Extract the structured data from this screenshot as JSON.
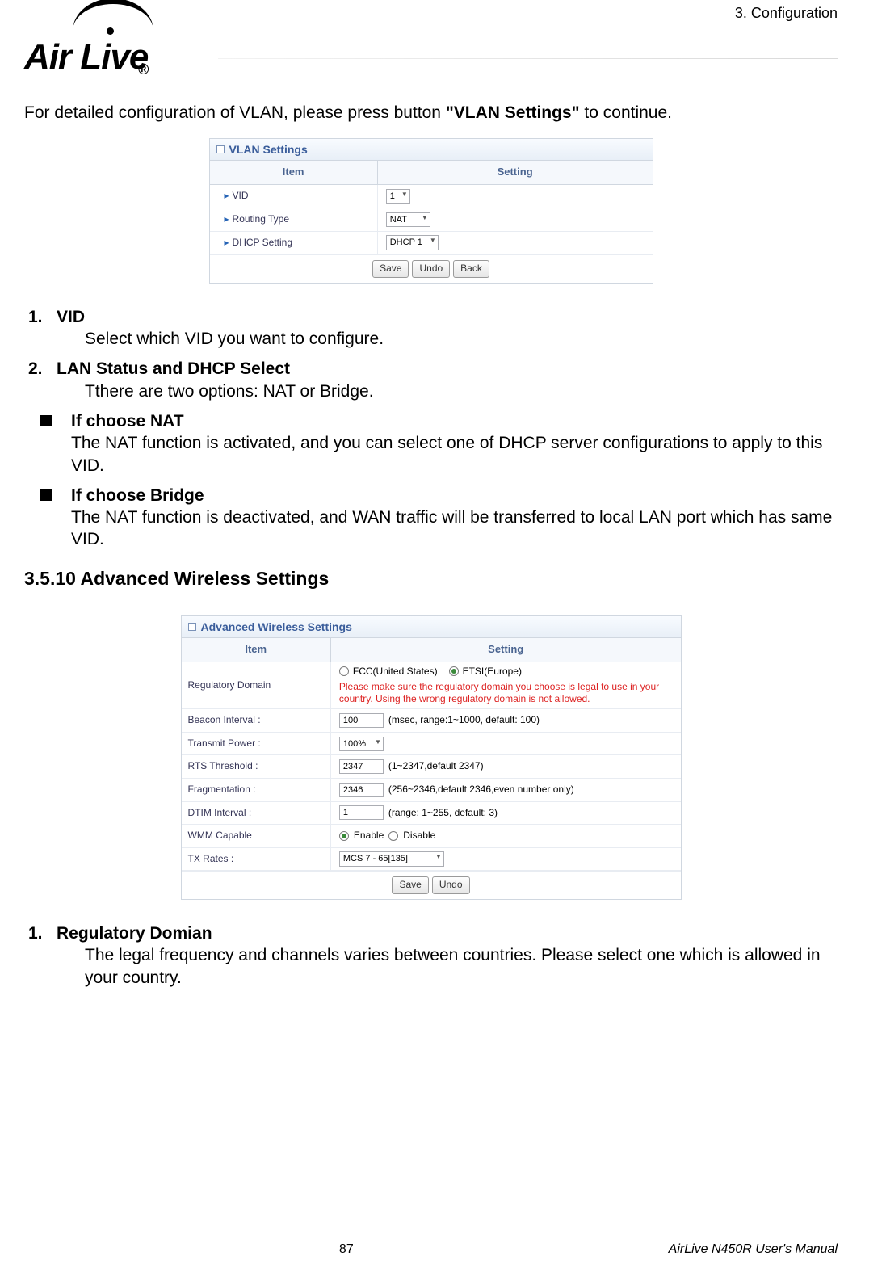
{
  "chapter": "3.  Configuration",
  "logo_text": "Air Live",
  "logo_reg": "®",
  "intro_pre": "For detailed configuration of VLAN, please press button ",
  "intro_bold": "\"VLAN Settings\"",
  "intro_post": " to continue.",
  "vlan": {
    "title": "VLAN Settings",
    "col_item": "Item",
    "col_setting": "Setting",
    "rows": {
      "vid": {
        "label": "VID",
        "value": "1"
      },
      "routing": {
        "label": "Routing Type",
        "value": "NAT"
      },
      "dhcp": {
        "label": "DHCP Setting",
        "value": "DHCP 1"
      }
    },
    "btn_save": "Save",
    "btn_undo": "Undo",
    "btn_back": "Back"
  },
  "items": {
    "n1": "1.",
    "t1": "VID",
    "b1": "Select which VID you want to configure.",
    "n2": "2.",
    "t2": "LAN Status and DHCP Select",
    "b2": "Tthere are two options: NAT or Bridge.",
    "bt1": "If choose NAT",
    "bb1": "The NAT function is activated, and you can select one of DHCP server configurations to apply to this VID.",
    "bt2": "If choose Bridge",
    "bb2": "The NAT function is deactivated, and WAN traffic will be transferred to local LAN port which has same VID."
  },
  "section_heading": "3.5.10 Advanced Wireless Settings",
  "aws": {
    "title": "Advanced Wireless Settings",
    "col_item": "Item",
    "col_setting": "Setting",
    "reg_label": "Regulatory Domain",
    "reg_opt1": "FCC(United States)",
    "reg_opt2": "ETSI(Europe)",
    "reg_warn": "Please make sure the regulatory domain you choose is legal to use in your country. Using the wrong regulatory domain is not allowed.",
    "beacon_label": "Beacon Interval :",
    "beacon_val": "100",
    "beacon_hint": "(msec, range:1~1000, default: 100)",
    "tx_pwr_label": "Transmit Power :",
    "tx_pwr_val": "100%",
    "rts_label": "RTS Threshold :",
    "rts_val": "2347",
    "rts_hint": "(1~2347,default 2347)",
    "frag_label": "Fragmentation :",
    "frag_val": "2346",
    "frag_hint": "(256~2346,default 2346,even number only)",
    "dtim_label": "DTIM Interval :",
    "dtim_val": "1",
    "dtim_hint": "(range: 1~255, default: 3)",
    "wmm_label": "WMM Capable",
    "wmm_enable": "Enable",
    "wmm_disable": "Disable",
    "txrates_label": "TX Rates :",
    "txrates_val": "MCS 7 - 65[135]",
    "btn_save": "Save",
    "btn_undo": "Undo"
  },
  "reg_item": {
    "num": "1.",
    "title": "Regulatory Domian",
    "body": "The legal frequency and channels varies between countries.    Please select one which is allowed in your country."
  },
  "footer": {
    "page": "87",
    "manual": "AirLive N450R User's Manual"
  }
}
